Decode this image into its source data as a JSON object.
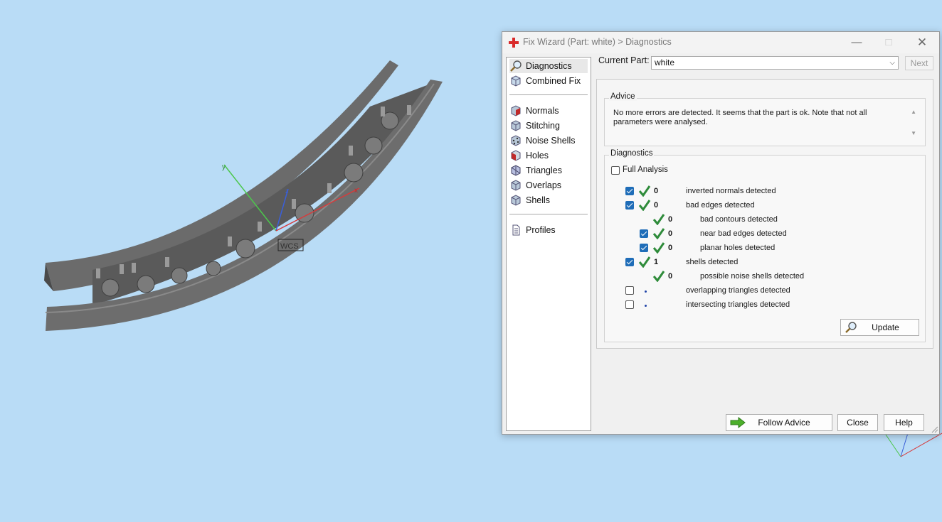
{
  "viewport": {
    "axis_label": "WCS",
    "axis_x": "x",
    "axis_y": "y",
    "axis_z": "z"
  },
  "window": {
    "title": "Fix Wizard (Part: white) > Diagnostics",
    "minimize_icon": "minimize-icon",
    "maximize_icon": "maximize-icon",
    "close_icon": "close-icon"
  },
  "nav": {
    "top": [
      {
        "label": "Diagnostics",
        "icon": "magnifier-icon",
        "active": true
      },
      {
        "label": "Combined Fix",
        "icon": "cube-icon",
        "active": false
      }
    ],
    "fixes": [
      {
        "label": "Normals",
        "icon": "normals-cube-icon"
      },
      {
        "label": "Stitching",
        "icon": "stitching-cube-icon"
      },
      {
        "label": "Noise Shells",
        "icon": "noise-shells-icon"
      },
      {
        "label": "Holes",
        "icon": "holes-cube-icon"
      },
      {
        "label": "Triangles",
        "icon": "triangles-cube-icon"
      },
      {
        "label": "Overlaps",
        "icon": "overlaps-cube-icon"
      },
      {
        "label": "Shells",
        "icon": "shells-cube-icon"
      }
    ],
    "profiles": {
      "label": "Profiles",
      "icon": "document-icon"
    }
  },
  "current_part": {
    "label": "Current Part:",
    "value": "white",
    "next_label": "Next"
  },
  "advice": {
    "title": "Advice",
    "text": "No more errors are detected. It seems that the part is ok. Note that not all parameters were analysed."
  },
  "diagnostics": {
    "title": "Diagnostics",
    "full_analysis_label": "Full Analysis",
    "full_analysis_checked": false,
    "rows": [
      {
        "checkbox": "on",
        "status": "ok",
        "count": "0",
        "label": "inverted normals detected",
        "indent": 0
      },
      {
        "checkbox": "on",
        "status": "ok",
        "count": "0",
        "label": "bad edges detected",
        "indent": 0
      },
      {
        "checkbox": "none",
        "status": "ok",
        "count": "0",
        "label": "bad contours detected",
        "indent": 1
      },
      {
        "checkbox": "on",
        "status": "ok",
        "count": "0",
        "label": "near bad edges detected",
        "indent": 1
      },
      {
        "checkbox": "on",
        "status": "ok",
        "count": "0",
        "label": "planar holes detected",
        "indent": 1
      },
      {
        "checkbox": "on",
        "status": "ok",
        "count": "1",
        "label": "shells detected",
        "indent": 0
      },
      {
        "checkbox": "none",
        "status": "ok",
        "count": "0",
        "label": "possible noise shells detected",
        "indent": 1
      },
      {
        "checkbox": "off",
        "status": "dot",
        "count": "",
        "label": "overlapping triangles detected",
        "indent": 0
      },
      {
        "checkbox": "off",
        "status": "dot",
        "count": "",
        "label": "intersecting triangles detected",
        "indent": 0
      }
    ],
    "update_label": "Update"
  },
  "footer": {
    "follow_advice_label": "Follow Advice",
    "close_label": "Close",
    "help_label": "Help"
  },
  "colors": {
    "background": "#b9dcf6",
    "check_green": "#2e8b3a",
    "accent_blue": "#1f6db8"
  }
}
